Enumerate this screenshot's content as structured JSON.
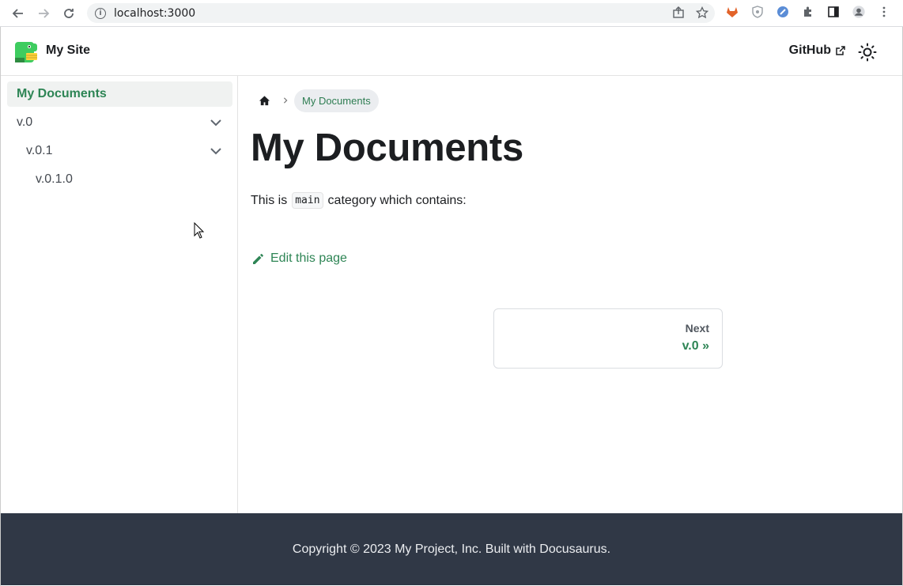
{
  "browser": {
    "url": "localhost:3000",
    "info_glyph": "i"
  },
  "navbar": {
    "brand": "My Site",
    "github_label": "GitHub"
  },
  "sidebar": {
    "items": [
      {
        "label": "My Documents",
        "active": true
      },
      {
        "label": "v.0",
        "expanded": true
      },
      {
        "label": "v.0.1",
        "expanded": true
      },
      {
        "label": "v.0.1.0"
      }
    ]
  },
  "main": {
    "breadcrumb": "My Documents",
    "title": "My Documents",
    "text_before": "This is",
    "code": "main",
    "text_after": "category which contains:",
    "edit_label": "Edit this page",
    "pagination": {
      "sublabel": "Next",
      "label": "v.0 »"
    }
  },
  "footer": {
    "copyright": "Copyright © 2023 My Project, Inc. Built with Docusaurus."
  },
  "colors": {
    "primary": "#2e8555",
    "footer_bg": "#303846"
  }
}
